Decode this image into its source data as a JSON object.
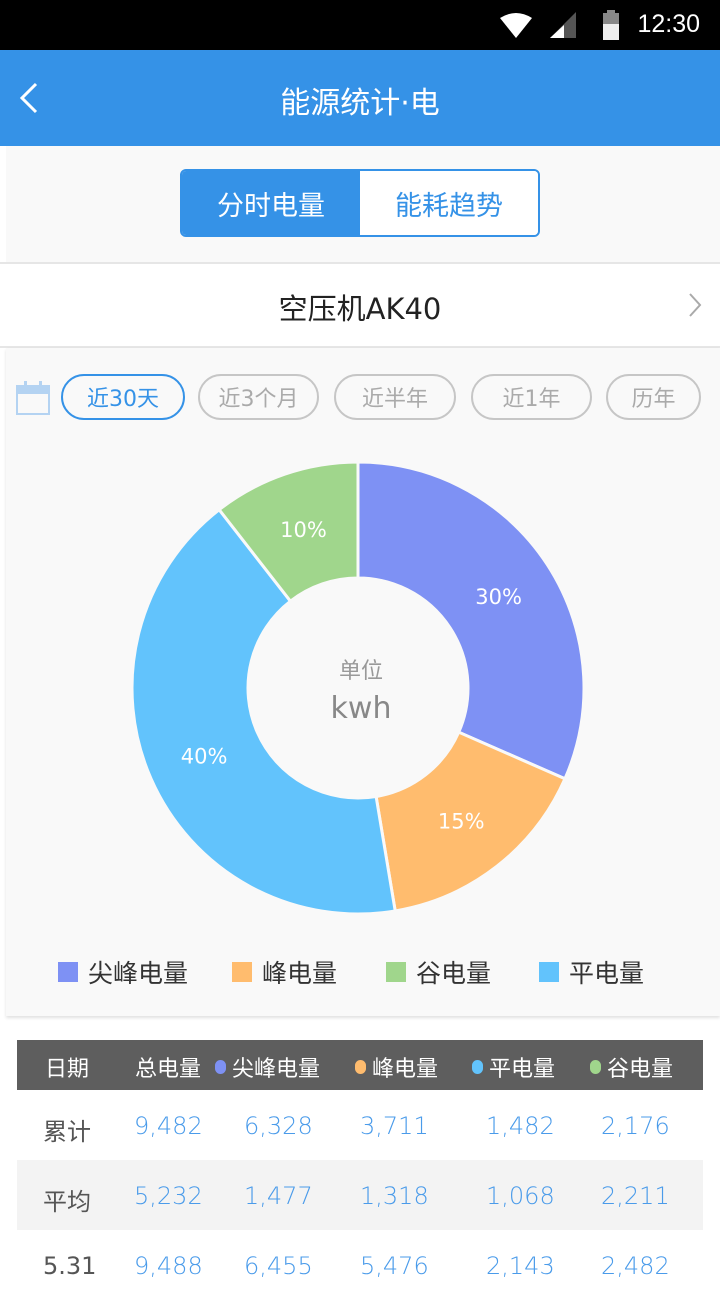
{
  "status_bar": {
    "time": "12:30"
  },
  "app_bar": {
    "title": "能源统计·电"
  },
  "segments": [
    {
      "label": "分时电量",
      "active": true
    },
    {
      "label": "能耗趋势",
      "active": false
    }
  ],
  "device": {
    "name": "空压机AK40"
  },
  "range_filters": [
    {
      "label": "近30天",
      "active": true
    },
    {
      "label": "近3个月",
      "active": false
    },
    {
      "label": "近半年",
      "active": false
    },
    {
      "label": "近1年",
      "active": false
    },
    {
      "label": "历年",
      "active": false
    }
  ],
  "colors": {
    "accent": "#3592E7",
    "sharp_peak": "#7E91F4",
    "peak": "#FFBC6E",
    "valley": "#A0D68C",
    "flat": "#62C3FC"
  },
  "chart_data": {
    "type": "pie",
    "donut": true,
    "center_label": "单位",
    "center_unit": "kwh",
    "slices": [
      {
        "name": "尖峰电量",
        "value": 30,
        "label": "30%",
        "color": "#7E91F4"
      },
      {
        "name": "峰电量",
        "value": 15,
        "label": "15%",
        "color": "#FFBC6E"
      },
      {
        "name": "平电量",
        "value": 40,
        "label": "40%",
        "color": "#62C3FC"
      },
      {
        "name": "谷电量",
        "value": 10,
        "label": "10%",
        "color": "#A0D68C"
      }
    ],
    "legend": [
      {
        "name": "尖峰电量",
        "color": "#7E91F4"
      },
      {
        "name": "峰电量",
        "color": "#FFBC6E"
      },
      {
        "name": "谷电量",
        "color": "#A0D68C"
      },
      {
        "name": "平电量",
        "color": "#62C3FC"
      }
    ],
    "legend_position": "bottom"
  },
  "table": {
    "headers": [
      "日期",
      "总电量",
      "尖峰电量",
      "峰电量",
      "平电量",
      "谷电量"
    ],
    "header_dots": [
      null,
      null,
      "#7E91F4",
      "#FFBC6E",
      "#62C3FC",
      "#A0D68C"
    ],
    "rows": [
      [
        "累计",
        "9,482",
        "6,328",
        "3,711",
        "1,482",
        "2,176"
      ],
      [
        "平均",
        "5,232",
        "1,477",
        "1,318",
        "1,068",
        "2,211"
      ],
      [
        "5.31",
        "9,488",
        "6,455",
        "5,476",
        "2,143",
        "2,482"
      ]
    ]
  }
}
